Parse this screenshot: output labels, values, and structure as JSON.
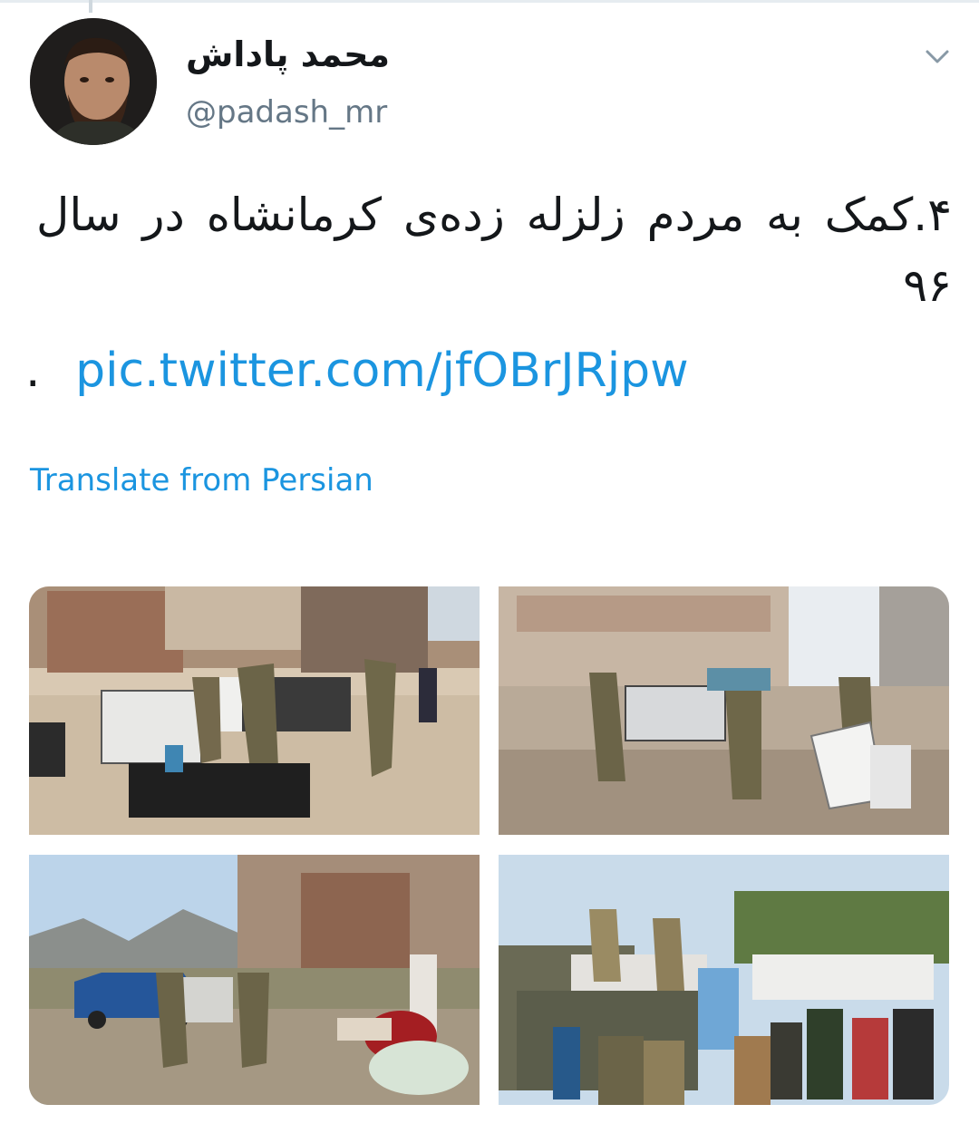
{
  "tweet": {
    "display_name": "محمد پاداش",
    "handle": "@padash_mr",
    "text": "۴.کمک به مردم زلزله زده‌ی کرمانشاه در سال ۹۶",
    "trailing_dot": ".",
    "link_text": "pic.twitter.com/jfOBrJRjpw",
    "translate_label": "Translate from Persian",
    "icons": {
      "avatar": "profile-photo",
      "caret": "chevron-down-icon"
    },
    "colors": {
      "link": "#1b95e0",
      "handle": "#657786",
      "text": "#14171a"
    }
  }
}
